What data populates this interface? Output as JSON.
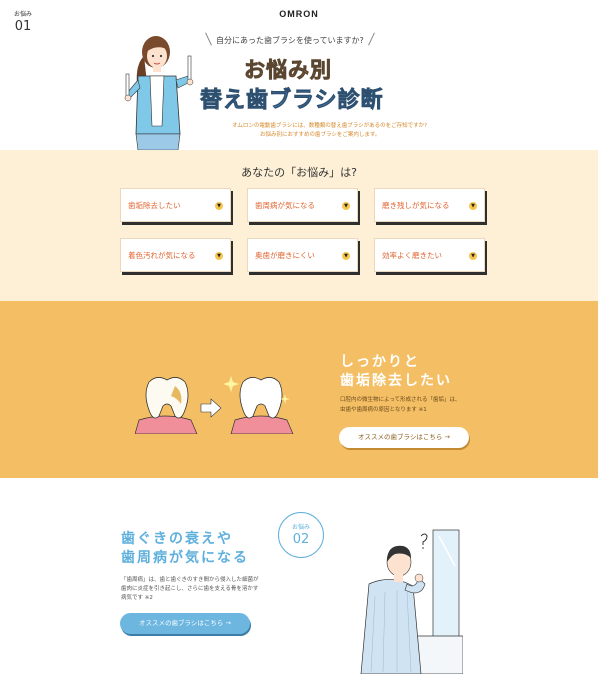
{
  "header": {
    "logo": "OMRON"
  },
  "hero": {
    "question": "自分にあった歯ブラシを使っていますか?",
    "title_line1": "お悩み別",
    "title_line2": "替え歯ブラシ診断",
    "desc_line1": "オムロンの電動歯ブラシには、数種類の替え歯ブラシがあるのをご存知ですか?",
    "desc_line2": "お悩み別におすすめの歯ブラシをご案内します。"
  },
  "concerns": {
    "title": "あなたの「お悩み」は?",
    "items": [
      {
        "label": "歯垢除去したい"
      },
      {
        "label": "歯周病が気になる"
      },
      {
        "label": "磨き残しが気になる"
      },
      {
        "label": "着色汚れが気になる"
      },
      {
        "label": "奥歯が磨きにくい"
      },
      {
        "label": "効率よく磨きたい"
      }
    ],
    "arrow_glyph": "▼"
  },
  "section1": {
    "badge_label": "お悩み",
    "badge_num": "01",
    "title_line1": "しっかりと",
    "title_line2": "歯垢除去したい",
    "desc_line1": "口腔内の微生物によって形成される「歯垢」は、",
    "desc_line2": "虫歯や歯周病の原因となります ※1",
    "button": "オススメの歯ブラシはこちら →"
  },
  "section2": {
    "badge_label": "お悩み",
    "badge_num": "02",
    "title_line1": "歯ぐきの衰えや",
    "title_line2": "歯周病が気になる",
    "desc_line1": "「歯周病」は、歯と歯ぐきのすき間から侵入した細菌が",
    "desc_line2": "歯肉に炎症を引き起こし、さらに歯を支える骨を溶かす",
    "desc_line3": "病気です ※2",
    "button": "オススメの歯ブラシはこちら →"
  },
  "colors": {
    "accent_orange": "#f4bf64",
    "accent_blue": "#5fb0dc",
    "cream": "#fdf0d6",
    "card_text": "#e0632f"
  }
}
